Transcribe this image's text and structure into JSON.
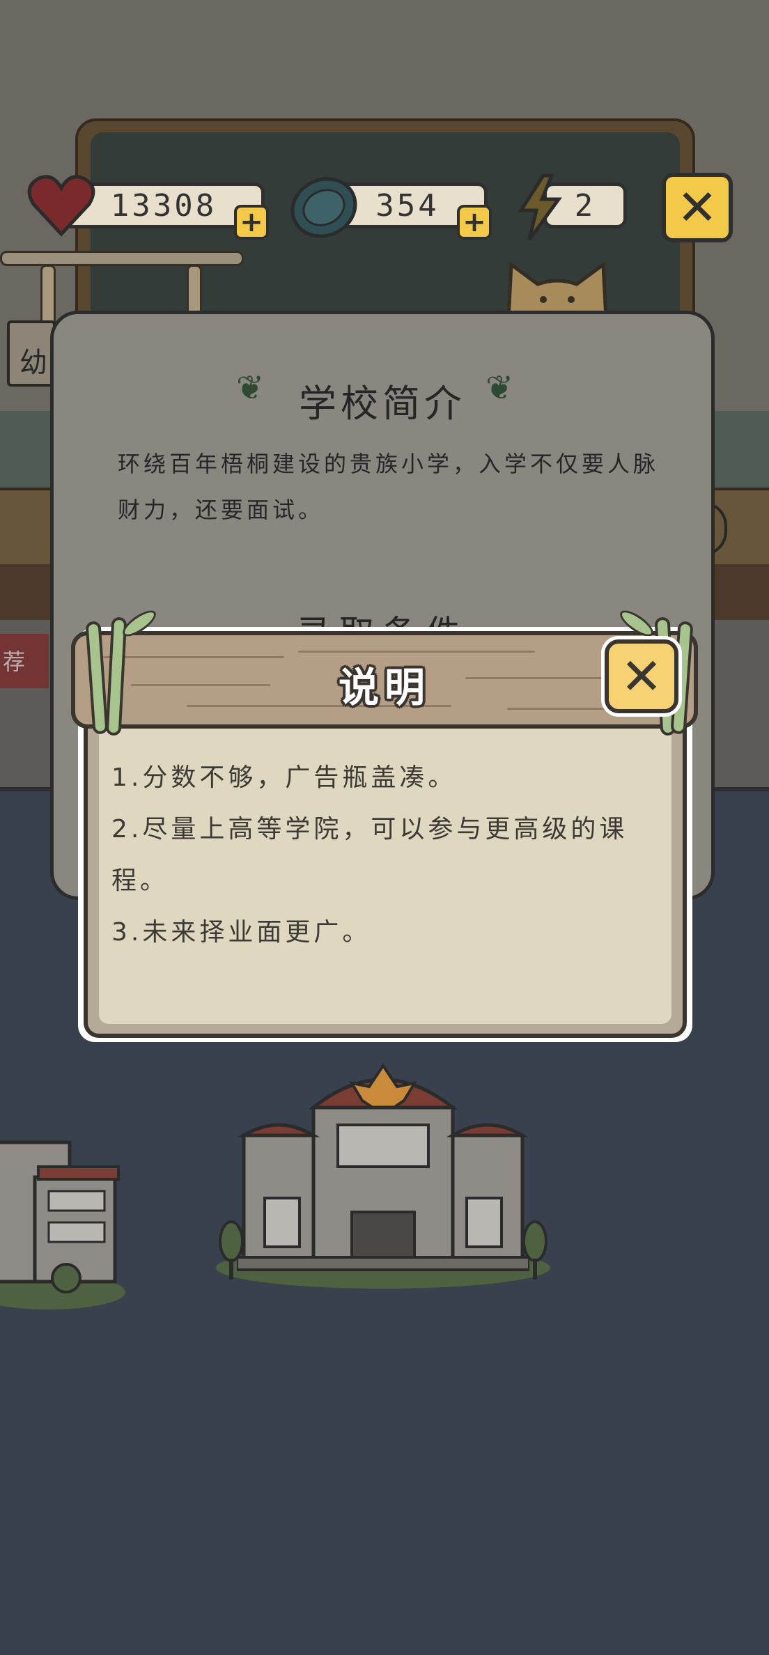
{
  "hud": {
    "hearts": "13308",
    "coins": "354",
    "energy": "2",
    "plus": "+",
    "close": "✕"
  },
  "background": {
    "side_sign": "幼",
    "side_ribbon": "荐"
  },
  "intro": {
    "title": "学校简介",
    "description": "环绕百年梧桐建设的贵族小学，入学不仅要人脉财力，还要面试。",
    "subtitle": "录取条件"
  },
  "dialog": {
    "title": "说明",
    "close": "✕",
    "lines": [
      "1.分数不够，广告瓶盖凑。",
      "2.尽量上高等学院，可以参与更高级的课程。",
      "3.未来择业面更广。"
    ]
  },
  "colors": {
    "accent_yellow": "#f3c94a",
    "dialog_paper": "#ded8c0",
    "wood": "#b59e86",
    "bamboo": "#a8c48e"
  }
}
